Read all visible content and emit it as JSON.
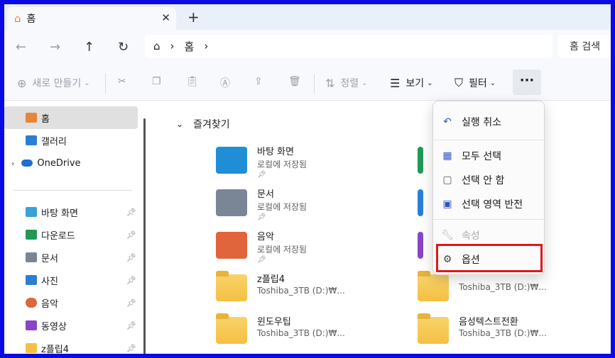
{
  "tab": {
    "title": "홈",
    "close": "✕",
    "new": "+"
  },
  "nav": {
    "back": "←",
    "forward": "→",
    "up": "↑",
    "refresh": "↻"
  },
  "address": {
    "home_glyph": "⌂",
    "sep1": "›",
    "crumb": "홈",
    "sep2": "›"
  },
  "search": {
    "placeholder": "홈 검색"
  },
  "commands": {
    "new": "새로 만들기",
    "sort": "정렬",
    "view": "보기",
    "filter": "필터",
    "more": "···"
  },
  "sidebar": {
    "items": [
      {
        "label": "홈",
        "color": "#e8853a"
      },
      {
        "label": "갤러리",
        "color": "#2a7fd4"
      },
      {
        "label": "OneDrive",
        "color": "#1f6fcf"
      },
      {
        "label": "바탕 화면",
        "color": "#3aa0d8"
      },
      {
        "label": "다운로드",
        "color": "#1f9a55"
      },
      {
        "label": "문서",
        "color": "#7a8696"
      },
      {
        "label": "사진",
        "color": "#2a7fd4"
      },
      {
        "label": "음악",
        "color": "#e0643c"
      },
      {
        "label": "동영상",
        "color": "#8a45c7"
      },
      {
        "label": "z플립4",
        "color": "#f4c043"
      }
    ]
  },
  "main": {
    "section_title": "즐겨찾기",
    "tiles": [
      {
        "name": "바탕 화면",
        "sub": "로컬에 저장됨",
        "color": "#1f8ed6"
      },
      {
        "name": "문서",
        "sub": "로컬에 저장됨",
        "color": "#7a8696"
      },
      {
        "name": "음악",
        "sub": "로컬에 저장됨",
        "color": "#e0643c"
      },
      {
        "name": "z플립4",
        "sub": "Toshiba_3TB (D:)₩..."
      },
      {
        "name": "윈도우팁",
        "sub": "Toshiba_3TB (D:)₩..."
      },
      {
        "name": "음성텍스트전환",
        "sub": "Toshiba_3TB (D:)₩..."
      }
    ],
    "right_partial": [
      {
        "name": "",
        "sub": "Toshiba_3TB (D:)₩..."
      }
    ]
  },
  "menu": {
    "undo": "실행 취소",
    "select_all": "모두 선택",
    "select_none": "선택 안 함",
    "invert": "선택 영역 반전",
    "properties": "속성",
    "options": "옵션"
  }
}
